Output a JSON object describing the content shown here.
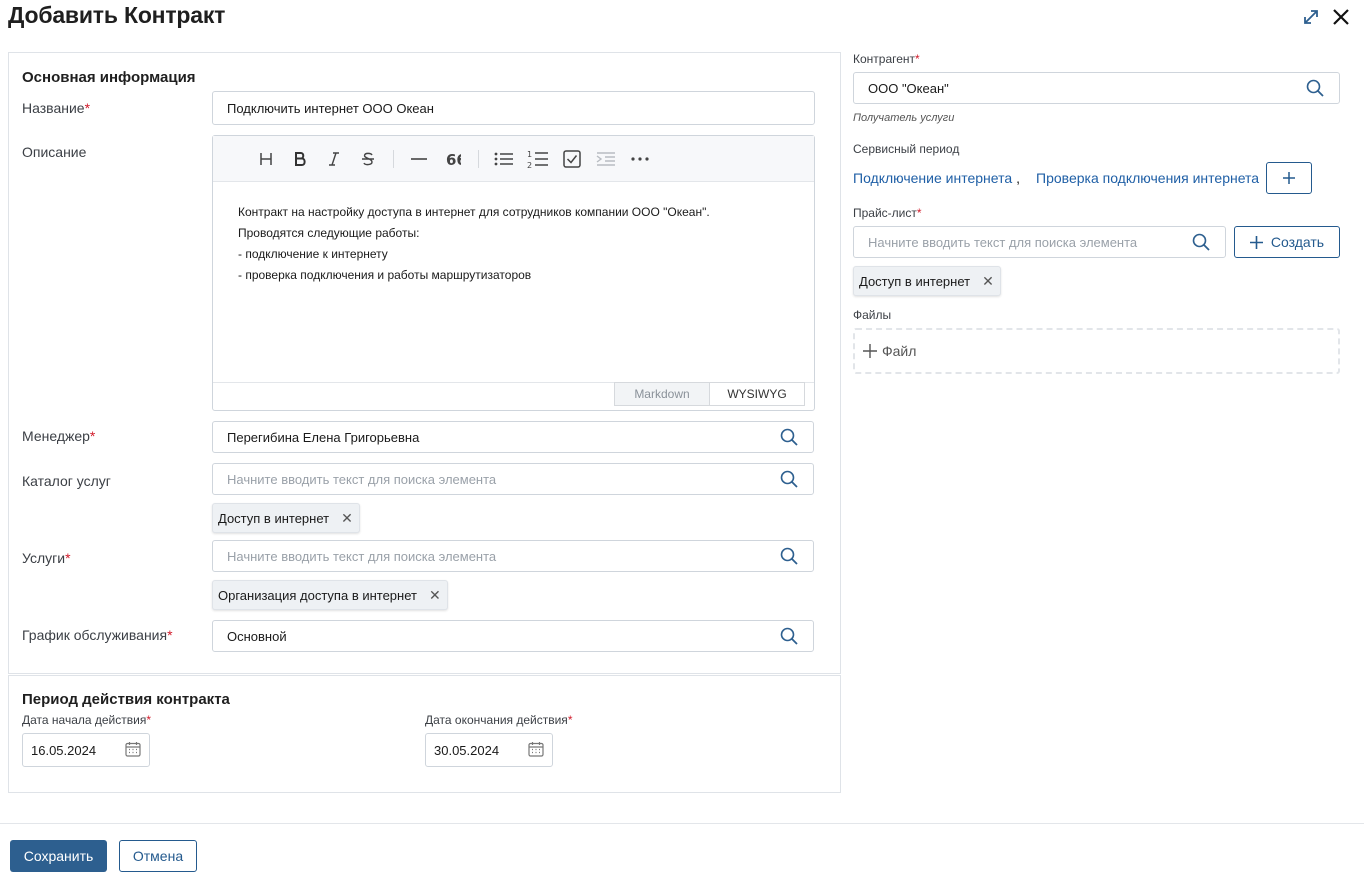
{
  "dialog": {
    "title": "Добавить Контракт"
  },
  "main": {
    "section_title": "Основная информация",
    "name": {
      "label": "Название",
      "value": "Подключить интернет ООО Океан"
    },
    "description": {
      "label": "Описание",
      "lines": [
        "Контракт на настройку доступа в интернет для сотрудников компании ООО \"Океан\".",
        "Проводятся следующие работы:",
        "- подключение к интернету",
        "- проверка подключения и работы маршрутизаторов"
      ],
      "modes": [
        "Markdown",
        "WYSIWYG"
      ],
      "active_mode": "WYSIWYG"
    },
    "manager": {
      "label": "Менеджер",
      "value": "Перегибина Елена Григорьевна"
    },
    "catalog": {
      "label": "Каталог услуг",
      "placeholder": "Начните вводить текст для поиска элемента",
      "tag": "Доступ в интернет"
    },
    "services": {
      "label": "Услуги",
      "placeholder": "Начните вводить текст для поиска элемента",
      "tag": "Организация доступа в интернет"
    },
    "schedule": {
      "label": "График обслуживания",
      "value": "Основной"
    }
  },
  "period": {
    "section_title": "Период действия контракта",
    "start": {
      "label": "Дата начала действия",
      "value": "16.05.2024"
    },
    "end": {
      "label": "Дата окончания действия",
      "value": "30.05.2024"
    }
  },
  "side": {
    "contractor": {
      "label": "Контрагент",
      "value": "ООО \"Океан\"",
      "hint": "Получатель услуги"
    },
    "service_period": {
      "label": "Сервисный период",
      "links": [
        "Подключение интернета",
        "Проверка подключения интернета"
      ],
      "separator": ","
    },
    "price_list": {
      "label": "Прайс-лист",
      "placeholder": "Начните вводить текст для поиска элемента",
      "create_label": "Создать",
      "tag": "Доступ в интернет"
    },
    "files": {
      "label": "Файлы",
      "add_label": "Файл"
    }
  },
  "footer": {
    "save_label": "Сохранить",
    "cancel_label": "Отмена"
  },
  "colors": {
    "accent": "#2d5f8f",
    "link": "#1f5fa6",
    "required": "#d11a2a"
  }
}
